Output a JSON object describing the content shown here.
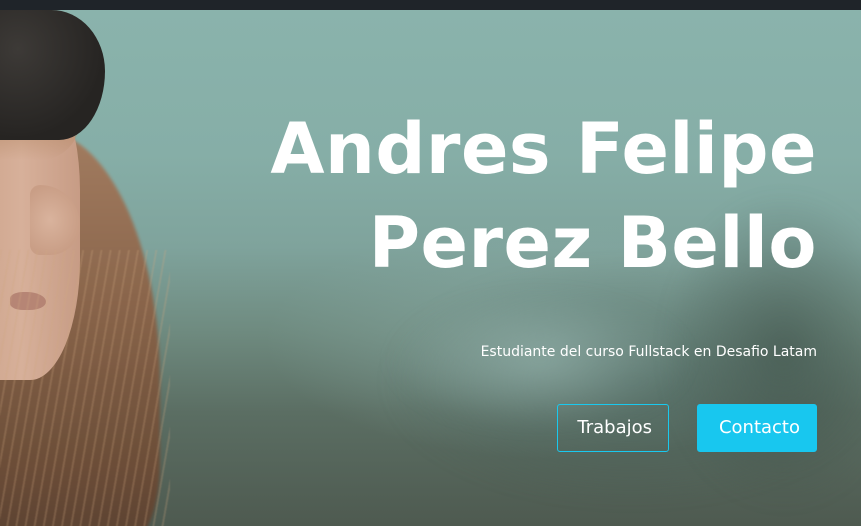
{
  "hero": {
    "name_line1": "Andres Felipe",
    "name_line2": "Perez Bello",
    "subtitle": "Estudiante del curso Fullstack en Desafio Latam"
  },
  "buttons": {
    "works_label": "Trabajos",
    "contact_label": "Contacto"
  },
  "colors": {
    "accent": "#18c7ef",
    "topbar": "#1f2429",
    "text": "#ffffff"
  }
}
